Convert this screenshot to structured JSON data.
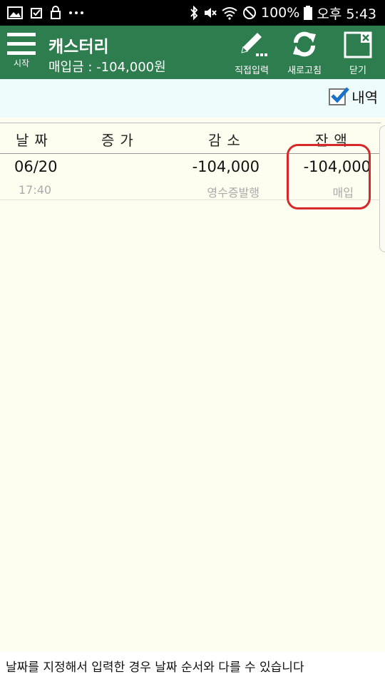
{
  "status_bar": {
    "battery": "100%",
    "time": "오후 5:43",
    "left_icons": [
      "image-icon",
      "check-icon",
      "lock-icon",
      "more-icon"
    ],
    "right_icons": [
      "bluetooth-icon",
      "mute-icon",
      "wifi-icon",
      "block-icon",
      "battery-icon"
    ]
  },
  "app_bar": {
    "menu_label": "시작",
    "title": "캐스터리",
    "subtitle": "매입금 : -104,000원",
    "actions": {
      "direct_input": "직접입력",
      "refresh": "새로고침",
      "close": "닫기"
    },
    "colors": {
      "background": "#2e7d4f"
    }
  },
  "sub_header": {
    "history_label": "내역",
    "history_checked": true
  },
  "table": {
    "headers": {
      "date": "날짜",
      "increase": "증가",
      "decrease": "감소",
      "balance": "잔액"
    },
    "rows": [
      {
        "date": "06/20",
        "time": "17:40",
        "increase": "",
        "decrease": "-104,000",
        "decrease_note": "영수증발행",
        "balance": "-104,000",
        "balance_note": "매입"
      }
    ]
  },
  "footer": {
    "note": "날짜를 지정해서 입력한 경우 날짜 순서와 다를 수 있습니다"
  },
  "highlight": {
    "color": "#d62828"
  }
}
